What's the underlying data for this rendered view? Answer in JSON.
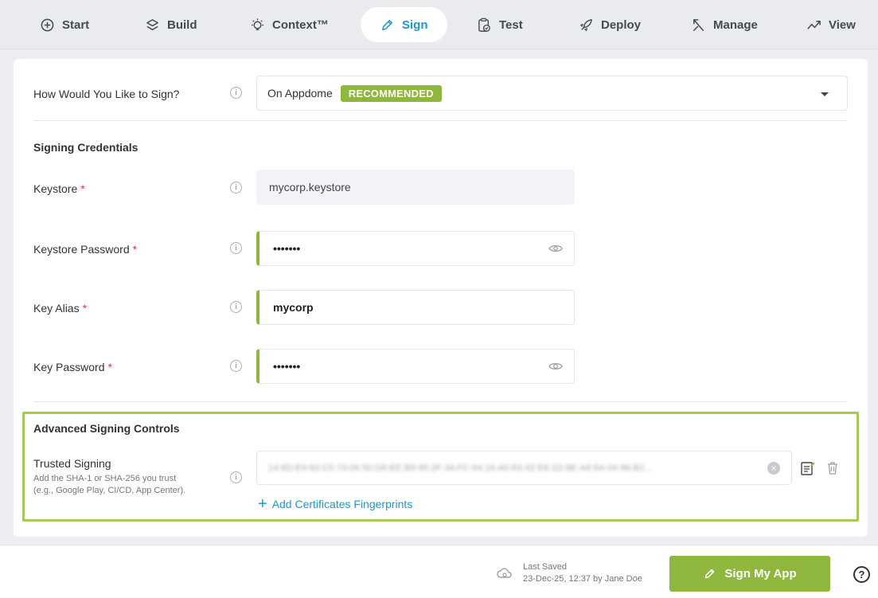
{
  "nav": {
    "tabs": [
      {
        "label": "Start",
        "icon": "plus-circle-icon"
      },
      {
        "label": "Build",
        "icon": "build-icon"
      },
      {
        "label": "Context™",
        "icon": "lightbulb-icon"
      },
      {
        "label": "Sign",
        "icon": "pen-icon",
        "active": true
      },
      {
        "label": "Test",
        "icon": "clipboard-check-icon"
      },
      {
        "label": "Deploy",
        "icon": "rocket-icon"
      },
      {
        "label": "Manage",
        "icon": "manage-icon"
      },
      {
        "label": "View",
        "icon": "chart-icon"
      }
    ]
  },
  "sign_method": {
    "label": "How Would You Like to Sign?",
    "value": "On Appdome",
    "badge": "RECOMMENDED"
  },
  "credentials": {
    "title": "Signing Credentials",
    "keystore": {
      "label": "Keystore",
      "required": "*",
      "value": "mycorp.keystore"
    },
    "keystore_password": {
      "label": "Keystore Password",
      "required": "*",
      "value": "•••••••"
    },
    "key_alias": {
      "label": "Key Alias",
      "required": "*",
      "value": "mycorp"
    },
    "key_password": {
      "label": "Key Password",
      "required": "*",
      "value": "•••••••"
    }
  },
  "advanced": {
    "title": "Advanced Signing Controls",
    "trusted_signing": {
      "label": "Trusted Signing",
      "help_line1": "Add the SHA-1 or SHA-256 you trust",
      "help_line2": "(e.g., Google Play, CI/CD, App Center).",
      "value": "14:6D:E9:83:C5:73:06:50:D8:EE:B9:95:2F:34:FC:64:16:A0:83:42:E6:1D:8E:A8:8A:04:96:B2..."
    },
    "add_link": "Add Certificates Fingerprints"
  },
  "footer": {
    "last_saved_label": "Last Saved",
    "last_saved_value": "23-Dec-25, 12:37 by Jane Doe",
    "sign_button": "Sign My App",
    "help": "?"
  },
  "colors": {
    "accent_green": "#8fb73e",
    "link_blue": "#1a9ac9",
    "required_red": "#d0384b"
  }
}
